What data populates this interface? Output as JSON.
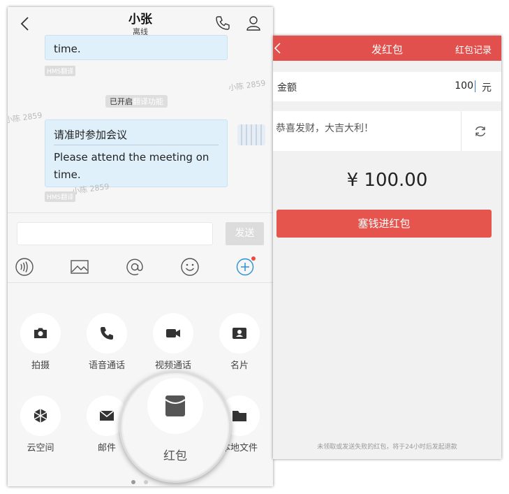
{
  "chat": {
    "title": "小张",
    "status": "离线",
    "msg1_tail": "time.",
    "hms_label": "HMS翻译",
    "system_prefix": "已开启",
    "system_highlight": "翻译功能",
    "msg2_cn": "请准时参加会议",
    "msg2_en": "Please attend the meeting on time.",
    "watermark": "小陈 2859",
    "send_label": "发送"
  },
  "icons": [
    "voice-icon",
    "image-icon",
    "at-icon",
    "emoji-icon",
    "plus-icon"
  ],
  "actions": {
    "row1": [
      {
        "label": "拍摄",
        "icon": "camera-icon"
      },
      {
        "label": "语音通话",
        "icon": "phone-icon"
      },
      {
        "label": "视频通话",
        "icon": "video-icon"
      },
      {
        "label": "名片",
        "icon": "contact-card-icon"
      }
    ],
    "row2": [
      {
        "label": "云空间",
        "icon": "cloud-space-icon"
      },
      {
        "label": "邮件",
        "icon": "mail-icon"
      },
      {
        "label": "本地文件",
        "icon": "folder-icon"
      }
    ],
    "highlight": {
      "label": "红包",
      "icon": "red-packet-icon"
    }
  },
  "redpacket": {
    "title": "发红包",
    "records_label": "红包记录",
    "amount_label": "金额",
    "amount_value": "100",
    "amount_unit": "元",
    "message": "恭喜发财，大吉大利！",
    "total": "¥ 100.00",
    "submit_label": "塞钱进红包",
    "note": "未领取或发送失败的红包，将于24小时后发起退款"
  },
  "colors": {
    "accent_red": "#e2504d",
    "bubble": "#dff0fb",
    "badge": "#ee4b3c",
    "link_blue": "#2b8fd6"
  }
}
